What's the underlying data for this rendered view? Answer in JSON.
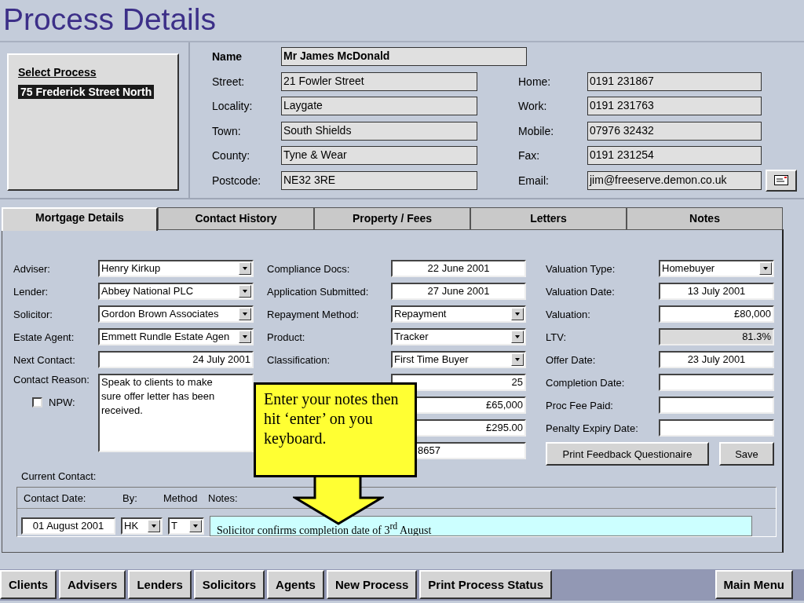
{
  "title": "Process Details",
  "select_process": {
    "heading": "Select Process",
    "items": [
      {
        "label": "75 Frederick Street North",
        "selected": true
      }
    ]
  },
  "contact": {
    "name": {
      "label": "Name",
      "value": "Mr James McDonald"
    },
    "address": [
      {
        "label": "Street:",
        "value": "21 Fowler Street"
      },
      {
        "label": "Locality:",
        "value": "Laygate"
      },
      {
        "label": "Town:",
        "value": "South Shields"
      },
      {
        "label": "County:",
        "value": "Tyne & Wear"
      },
      {
        "label": "Postcode:",
        "value": "NE32 3RE"
      }
    ],
    "phones": [
      {
        "label": "Home:",
        "value": "0191 231867"
      },
      {
        "label": "Work:",
        "value": "0191 231763"
      },
      {
        "label": "Mobile:",
        "value": "07976 32432"
      },
      {
        "label": "Fax:",
        "value": "0191 231254"
      },
      {
        "label": "Email:",
        "value": "jim@freeserve.demon.co.uk"
      }
    ]
  },
  "tabs": [
    {
      "label": "Mortgage Details",
      "selected": true
    },
    {
      "label": "Contact History",
      "selected": false
    },
    {
      "label": "Property / Fees",
      "selected": false
    },
    {
      "label": "Letters",
      "selected": false
    },
    {
      "label": "Notes",
      "selected": false
    }
  ],
  "mortgage": {
    "columns": [
      [
        {
          "label": "Adviser:",
          "value": "Henry Kirkup",
          "kind": "dropdown"
        },
        {
          "label": "Lender:",
          "value": "Abbey National PLC",
          "kind": "dropdown"
        },
        {
          "label": "Solicitor:",
          "value": "Gordon Brown Associates",
          "kind": "dropdown"
        },
        {
          "label": "Estate Agent:",
          "value": "Emmett Rundle Estate Agen",
          "kind": "dropdown"
        },
        {
          "label": "Next Contact:",
          "value": "24 July 2001",
          "kind": "number"
        }
      ],
      [
        {
          "label": "Compliance Docs:",
          "value": "22 June 2001",
          "kind": "date"
        },
        {
          "label": "Application Submitted:",
          "value": "27 June 2001",
          "kind": "date"
        },
        {
          "label": "Repayment Method:",
          "value": "Repayment",
          "kind": "dropdown"
        },
        {
          "label": "Product:",
          "value": "Tracker",
          "kind": "dropdown"
        },
        {
          "label": "Classification:",
          "value": "First Time Buyer",
          "kind": "dropdown"
        },
        {
          "value": "25",
          "kind": "number"
        },
        {
          "value": "£65,000",
          "kind": "number"
        },
        {
          "value": "£295.00",
          "kind": "number"
        },
        {
          "value": "8657",
          "kind": "partial"
        }
      ],
      [
        {
          "label": "Valuation Type:",
          "value": "Homebuyer",
          "kind": "dropdown"
        },
        {
          "label": "Valuation Date:",
          "value": "13 July 2001",
          "kind": "date"
        },
        {
          "label": "Valuation:",
          "value": "£80,000",
          "kind": "number"
        },
        {
          "label": "LTV:",
          "value": "81.3%",
          "kind": "readonly"
        },
        {
          "label": "Offer Date:",
          "value": "23 July 2001",
          "kind": "date"
        },
        {
          "label": "Completion Date:",
          "kind": "number"
        },
        {
          "label": "Proc Fee Paid:",
          "kind": "number"
        },
        {
          "label": "Penalty Expiry Date:",
          "kind": "number"
        }
      ]
    ],
    "contact_reason": {
      "label": "Contact Reason:",
      "value": "Speak to clients to make sure offer letter has been received."
    },
    "npw": {
      "label": "NPW:",
      "checked": false
    },
    "buttons": [
      "Print Feedback Questionaire",
      "Save"
    ]
  },
  "current_contact": {
    "label": "Current Contact:",
    "headers": [
      "Contact Date:",
      "By:",
      "Method",
      "Notes:"
    ],
    "date": "01 August 2001",
    "by": "HK",
    "method": "T",
    "notes": "Solicitor confirms completion date of 3$^{rd}$ August"
  },
  "callout": {
    "text": "Enter your notes then hit ‘enter’ on you  keyboard."
  },
  "nav": [
    "Clients",
    "Advisers",
    "Lenders",
    "Solicitors",
    "Agents",
    "New Process",
    "Print Process Status"
  ],
  "main_menu": "Main Menu"
}
